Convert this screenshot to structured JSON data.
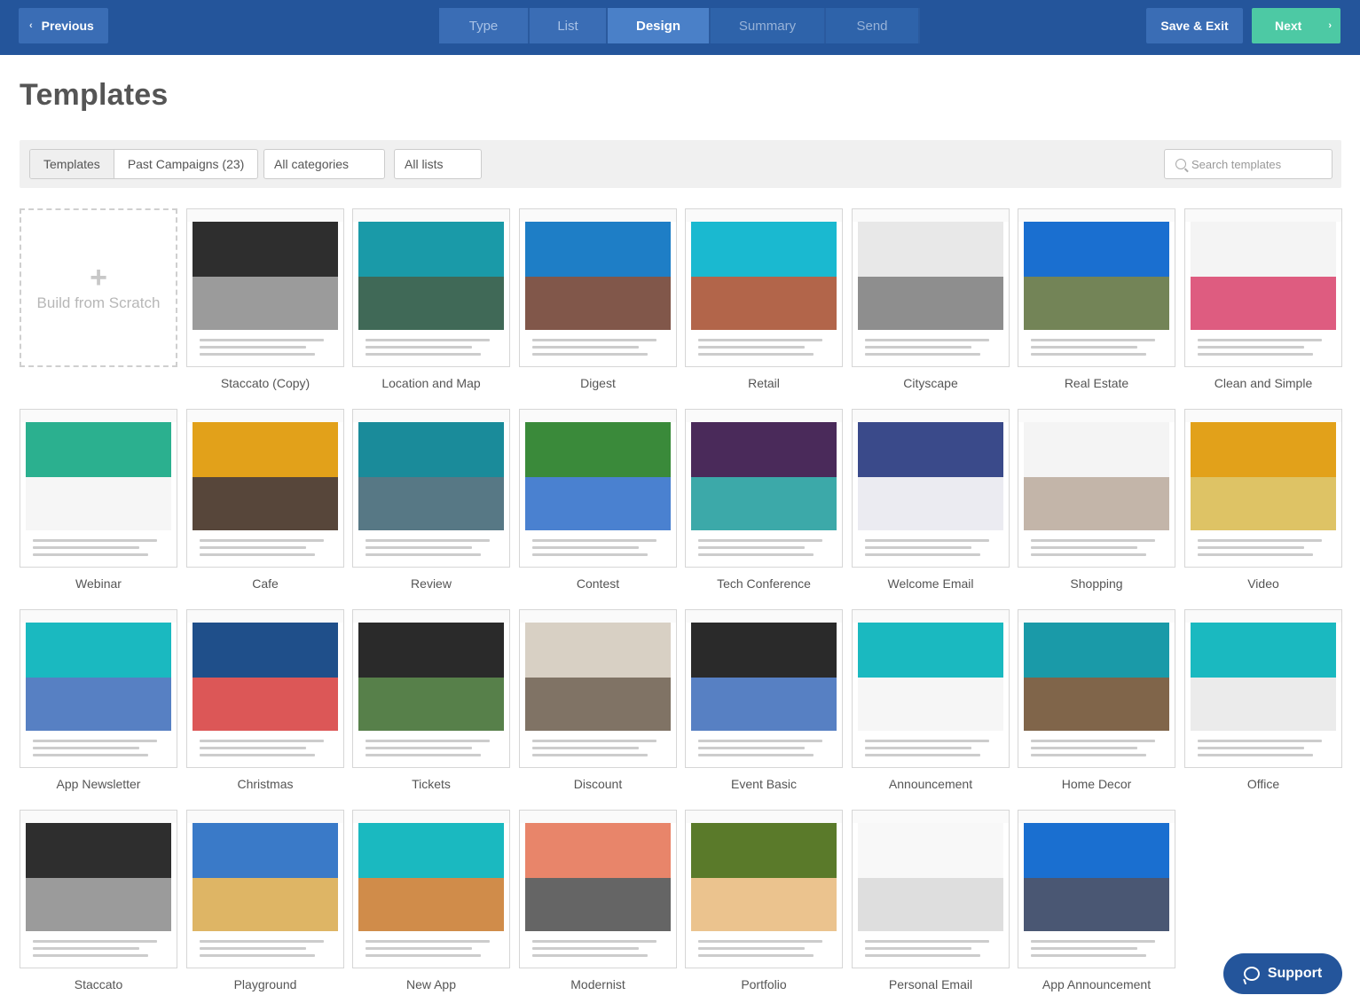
{
  "topbar": {
    "previous_label": "Previous",
    "steps": [
      {
        "label": "Type",
        "state": "done"
      },
      {
        "label": "List",
        "state": "done"
      },
      {
        "label": "Design",
        "state": "active"
      },
      {
        "label": "Summary",
        "state": "todo"
      },
      {
        "label": "Send",
        "state": "todo"
      }
    ],
    "save_exit_label": "Save & Exit",
    "next_label": "Next"
  },
  "page_title": "Templates",
  "filters": {
    "tab_templates": "Templates",
    "tab_past": "Past Campaigns (23)",
    "categories": "All categories",
    "lists": "All lists",
    "search_placeholder": "Search templates"
  },
  "scratch_label": "Build from Scratch",
  "templates": [
    {
      "name": "Staccato (Copy)",
      "color": "#2e2e2e",
      "accent": "#8a8a8a"
    },
    {
      "name": "Location and Map",
      "color": "#1a9aa8",
      "accent": "#1f4f3a"
    },
    {
      "name": "Digest",
      "color": "#1e7ec6",
      "accent": "#6b3a2a"
    },
    {
      "name": "Retail",
      "color": "#1ab9d0",
      "accent": "#a54a2a"
    },
    {
      "name": "Cityscape",
      "color": "#e8e8e8",
      "accent": "#7a7a7a"
    },
    {
      "name": "Real Estate",
      "color": "#1a6fd0",
      "accent": "#5a6e3a"
    },
    {
      "name": "Clean and Simple",
      "color": "#f4f4f4",
      "accent": "#d8406a"
    },
    {
      "name": "Webinar",
      "color": "#2bb08f",
      "accent": "#f4f4f4"
    },
    {
      "name": "Cafe",
      "color": "#e2a11a",
      "accent": "#3a2618"
    },
    {
      "name": "Review",
      "color": "#1a8b9a",
      "accent": "#3a6070"
    },
    {
      "name": "Contest",
      "color": "#3a8a3a",
      "accent": "#2a6bc8"
    },
    {
      "name": "Tech Conference",
      "color": "#4a2a5a",
      "accent": "#1a9a9a"
    },
    {
      "name": "Welcome Email",
      "color": "#3a4a8a",
      "accent": "#e8e8ee"
    },
    {
      "name": "Shopping",
      "color": "#f4f4f4",
      "accent": "#b8a89a"
    },
    {
      "name": "Video",
      "color": "#e2a11a",
      "accent": "#d8b84a"
    },
    {
      "name": "App Newsletter",
      "color": "#1ab9c0",
      "accent": "#3a6ab8"
    },
    {
      "name": "Christmas",
      "color": "#1f4f8a",
      "accent": "#d63a3a"
    },
    {
      "name": "Tickets",
      "color": "#2a2a2a",
      "accent": "#3a6a2a"
    },
    {
      "name": "Discount",
      "color": "#d8d0c4",
      "accent": "#6a5a4a"
    },
    {
      "name": "Event Basic",
      "color": "#2a2a2a",
      "accent": "#3a6ab8"
    },
    {
      "name": "Announcement",
      "color": "#1ab9c0",
      "accent": "#f4f4f4"
    },
    {
      "name": "Home Decor",
      "color": "#1a9aa8",
      "accent": "#6a4a2a"
    },
    {
      "name": "Office",
      "color": "#1ab9c0",
      "accent": "#e8e8e8"
    },
    {
      "name": "Staccato",
      "color": "#2e2e2e",
      "accent": "#8a8a8a"
    },
    {
      "name": "Playground",
      "color": "#3a7ac8",
      "accent": "#d8a84a"
    },
    {
      "name": "New App",
      "color": "#1ab9c0",
      "accent": "#c8782a"
    },
    {
      "name": "Modernist",
      "color": "#e8856a",
      "accent": "#4a4a4a"
    },
    {
      "name": "Portfolio",
      "color": "#5a7a2a",
      "accent": "#e8b87a"
    },
    {
      "name": "Personal Email",
      "color": "#f8f8f8",
      "accent": "#d8d8d8"
    },
    {
      "name": "App Announcement",
      "color": "#1a6fd0",
      "accent": "#2a3a5a"
    }
  ],
  "support_label": "Support"
}
